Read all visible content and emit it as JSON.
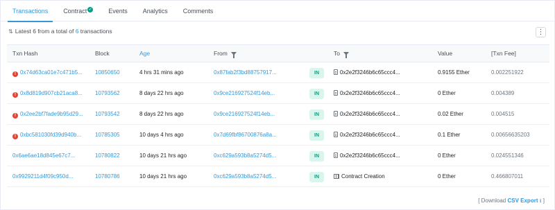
{
  "tabs": [
    {
      "label": "Transactions",
      "active": true
    },
    {
      "label": "Contract",
      "verified": true
    },
    {
      "label": "Events"
    },
    {
      "label": "Analytics"
    },
    {
      "label": "Comments"
    }
  ],
  "summary": {
    "prefix": "Latest",
    "shown": "6",
    "middle": "from a total of",
    "total": "6",
    "suffix": "transactions"
  },
  "more_button": "⋮",
  "table": {
    "headers": {
      "txn_hash": "Txn Hash",
      "block": "Block",
      "age": "Age",
      "from": "From",
      "to": "To",
      "value": "Value",
      "txn_fee": "[Txn Fee]"
    },
    "rows": [
      {
        "error": true,
        "hash": "0x74d63ca01e7c471b5...",
        "block": "10850650",
        "age": "4 hrs 31 mins ago",
        "from": "0x87fab2f3bd88757917...",
        "direction": "IN",
        "to_type": "contract",
        "to": "0x2e2f3246b6c65ccc4...",
        "value": "0.9155 Ether",
        "fee": "0.002251922"
      },
      {
        "error": true,
        "hash": "0x8d819d907cb21aca8...",
        "block": "10793562",
        "age": "8 days 22 hrs ago",
        "from": "0x9ce216927524f14eb...",
        "direction": "IN",
        "to_type": "contract",
        "to": "0x2e2f3246b6c65ccc4...",
        "value": "0 Ether",
        "fee": "0.004389"
      },
      {
        "error": true,
        "hash": "0x2ee2bf7fade9b95d29...",
        "block": "10793542",
        "age": "8 days 22 hrs ago",
        "from": "0x9ce216927524f14eb...",
        "direction": "IN",
        "to_type": "contract",
        "to": "0x2e2f3246b6c65ccc4...",
        "value": "0.02 Ether",
        "fee": "0.004515"
      },
      {
        "error": true,
        "hash": "0xbc581030fd39d940b...",
        "block": "10785305",
        "age": "10 days 4 hrs ago",
        "from": "0x7d69fbf86700876a8a...",
        "direction": "IN",
        "to_type": "contract",
        "to": "0x2e2f3246b6c65ccc4...",
        "value": "0.1 Ether",
        "fee": "0.00656635203"
      },
      {
        "error": false,
        "hash": "0x6ae6ae18d845e67c7...",
        "block": "10780822",
        "age": "10 days 21 hrs ago",
        "from": "0xc629a593b8a5274d5...",
        "direction": "IN",
        "to_type": "contract",
        "to": "0x2e2f3246b6c65ccc4...",
        "value": "0 Ether",
        "fee": "0.024551346"
      },
      {
        "error": false,
        "hash": "0x9929211d4f09c950d...",
        "block": "10780786",
        "age": "10 days 21 hrs ago",
        "from": "0xc629a593b8a5274d5...",
        "direction": "IN",
        "to_type": "creation",
        "to": "Contract Creation",
        "value": "0 Ether",
        "fee": "0.466807011"
      }
    ]
  },
  "footer": {
    "open": "[ Download",
    "csv": "CSV Export",
    "close": "]",
    "icon": "download-icon"
  },
  "colors": {
    "accent": "#3498db",
    "error": "#de4437",
    "in_badge_bg": "#daf5ec",
    "in_badge_text": "#00a186"
  }
}
